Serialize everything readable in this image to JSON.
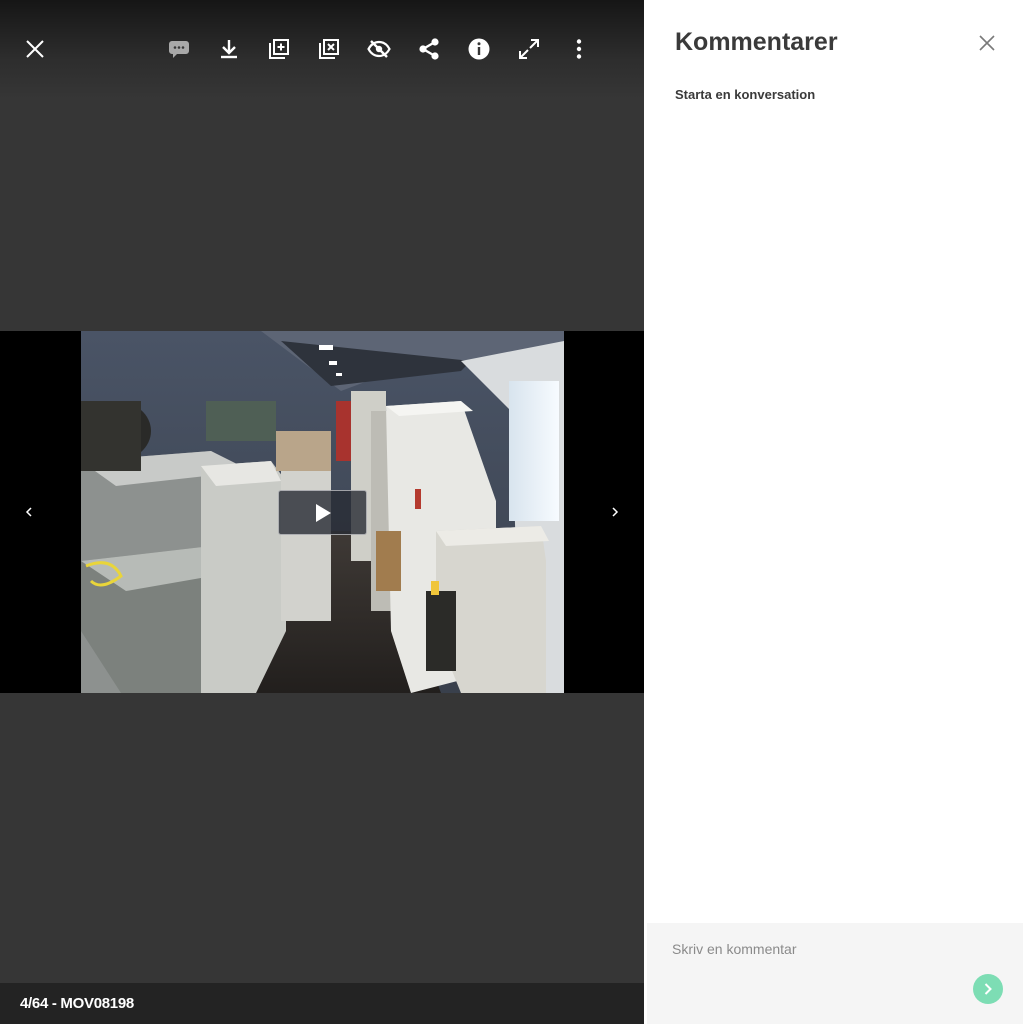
{
  "viewer": {
    "toolbar": {
      "icons": [
        "close-icon",
        "comment-icon",
        "download-icon",
        "add-to-album-icon",
        "remove-from-album-icon",
        "hide-icon",
        "share-icon",
        "info-icon",
        "fullscreen-icon",
        "more-icon"
      ]
    },
    "media": {
      "type": "video",
      "play_icon": "play-icon"
    },
    "caption": "4/64 - MOV08198"
  },
  "comments_panel": {
    "title": "Kommentarer",
    "subtitle": "Starta en konversation",
    "input_placeholder": "Skriv en kommentar",
    "input_value": "",
    "send_icon": "chevron-right-icon"
  },
  "colors": {
    "viewer_bg": "#363636",
    "caption_bg": "#232323",
    "panel_bg": "#ffffff",
    "send_button": "#7dddb4",
    "text_dark": "#3a3a3a"
  }
}
